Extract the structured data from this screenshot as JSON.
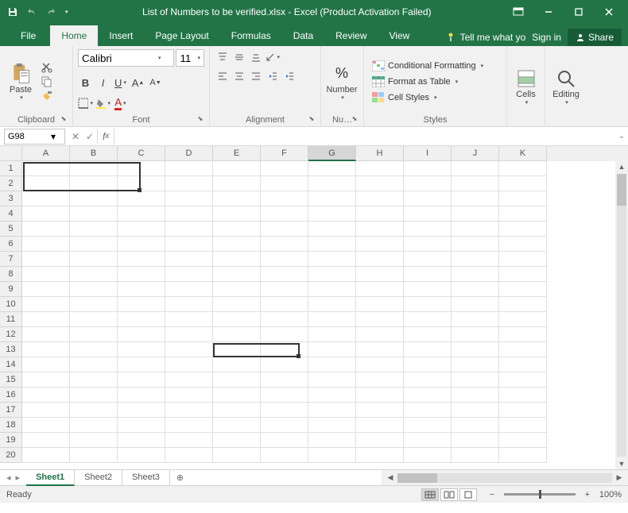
{
  "titlebar": {
    "title": "List of Numbers to be verified.xlsx - Excel (Product Activation Failed)"
  },
  "tabs": {
    "file": "File",
    "home": "Home",
    "insert": "Insert",
    "page_layout": "Page Layout",
    "formulas": "Formulas",
    "data": "Data",
    "review": "Review",
    "view": "View",
    "tell_me": "Tell me what yo",
    "sign_in": "Sign in",
    "share": "Share"
  },
  "ribbon": {
    "clipboard": {
      "label": "Clipboard",
      "paste": "Paste"
    },
    "font": {
      "label": "Font",
      "name": "Calibri",
      "size": "11"
    },
    "alignment": {
      "label": "Alignment"
    },
    "number": {
      "label": "Nu…",
      "btn": "Number"
    },
    "styles": {
      "label": "Styles",
      "cond_format": "Conditional Formatting",
      "as_table": "Format as Table",
      "cell_styles": "Cell Styles"
    },
    "cells": {
      "label": "Cells"
    },
    "editing": {
      "label": "Editing"
    }
  },
  "formula_bar": {
    "name_box": "G98",
    "formula": ""
  },
  "grid": {
    "columns": [
      "A",
      "B",
      "C",
      "D",
      "E",
      "F",
      "G",
      "H",
      "I",
      "J",
      "K"
    ],
    "active_column": "G",
    "rows": [
      1,
      2,
      3,
      4,
      5,
      6,
      7,
      8,
      9,
      10,
      11,
      12,
      13,
      14,
      15,
      16,
      17,
      18,
      19,
      20
    ]
  },
  "sheets": {
    "tabs": [
      "Sheet1",
      "Sheet2",
      "Sheet3"
    ],
    "active": "Sheet1"
  },
  "status": {
    "ready": "Ready",
    "zoom": "100%"
  }
}
